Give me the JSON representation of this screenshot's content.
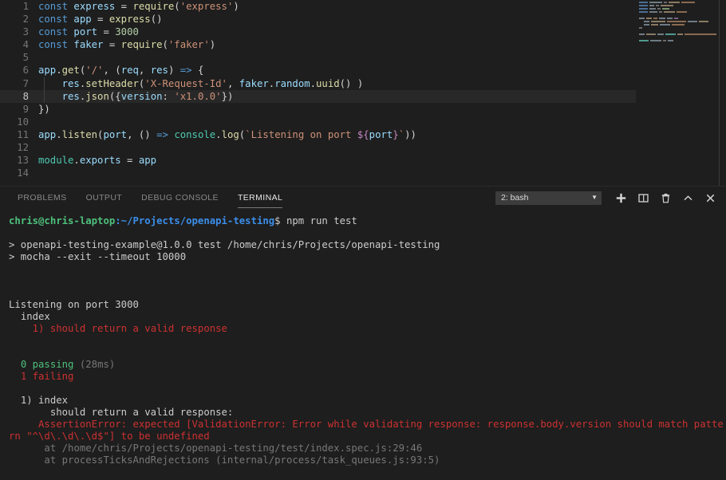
{
  "editor": {
    "lines": [
      {
        "num": "1",
        "active": false,
        "tokens": [
          {
            "t": "const ",
            "c": "t-kw"
          },
          {
            "t": "express",
            "c": "t-var"
          },
          {
            "t": " = ",
            "c": "t-op"
          },
          {
            "t": "require",
            "c": "t-fn"
          },
          {
            "t": "(",
            "c": "t-punc"
          },
          {
            "t": "'express'",
            "c": "t-str"
          },
          {
            "t": ")",
            "c": "t-punc"
          }
        ]
      },
      {
        "num": "2",
        "active": false,
        "tokens": [
          {
            "t": "const ",
            "c": "t-kw"
          },
          {
            "t": "app",
            "c": "t-var"
          },
          {
            "t": " = ",
            "c": "t-op"
          },
          {
            "t": "express",
            "c": "t-fn"
          },
          {
            "t": "()",
            "c": "t-punc"
          }
        ]
      },
      {
        "num": "3",
        "active": false,
        "tokens": [
          {
            "t": "const ",
            "c": "t-kw"
          },
          {
            "t": "port",
            "c": "t-var"
          },
          {
            "t": " = ",
            "c": "t-op"
          },
          {
            "t": "3000",
            "c": "t-num"
          }
        ]
      },
      {
        "num": "4",
        "active": false,
        "tokens": [
          {
            "t": "const ",
            "c": "t-kw"
          },
          {
            "t": "faker",
            "c": "t-var"
          },
          {
            "t": " = ",
            "c": "t-op"
          },
          {
            "t": "require",
            "c": "t-fn"
          },
          {
            "t": "(",
            "c": "t-punc"
          },
          {
            "t": "'faker'",
            "c": "t-str"
          },
          {
            "t": ")",
            "c": "t-punc"
          }
        ]
      },
      {
        "num": "5",
        "active": false,
        "tokens": []
      },
      {
        "num": "6",
        "active": false,
        "tokens": [
          {
            "t": "app",
            "c": "t-var"
          },
          {
            "t": ".",
            "c": "t-punc"
          },
          {
            "t": "get",
            "c": "t-fn"
          },
          {
            "t": "(",
            "c": "t-punc"
          },
          {
            "t": "'/'",
            "c": "t-str"
          },
          {
            "t": ", (",
            "c": "t-punc"
          },
          {
            "t": "req",
            "c": "t-var"
          },
          {
            "t": ", ",
            "c": "t-punc"
          },
          {
            "t": "res",
            "c": "t-var"
          },
          {
            "t": ") ",
            "c": "t-punc"
          },
          {
            "t": "=>",
            "c": "t-kw"
          },
          {
            "t": " {",
            "c": "t-punc"
          }
        ]
      },
      {
        "num": "7",
        "active": false,
        "indent": true,
        "tokens": [
          {
            "t": "    ",
            "c": "t-punc"
          },
          {
            "t": "res",
            "c": "t-var"
          },
          {
            "t": ".",
            "c": "t-punc"
          },
          {
            "t": "setHeader",
            "c": "t-fn"
          },
          {
            "t": "(",
            "c": "t-punc"
          },
          {
            "t": "'X-Request-Id'",
            "c": "t-str"
          },
          {
            "t": ", ",
            "c": "t-punc"
          },
          {
            "t": "faker",
            "c": "t-var"
          },
          {
            "t": ".",
            "c": "t-punc"
          },
          {
            "t": "random",
            "c": "t-var"
          },
          {
            "t": ".",
            "c": "t-punc"
          },
          {
            "t": "uuid",
            "c": "t-fn"
          },
          {
            "t": "() )",
            "c": "t-punc"
          }
        ]
      },
      {
        "num": "8",
        "active": true,
        "indent": true,
        "tokens": [
          {
            "t": "    ",
            "c": "t-punc"
          },
          {
            "t": "res",
            "c": "t-var"
          },
          {
            "t": ".",
            "c": "t-punc"
          },
          {
            "t": "json",
            "c": "t-fn"
          },
          {
            "t": "({",
            "c": "t-punc"
          },
          {
            "t": "version",
            "c": "t-var"
          },
          {
            "t": ": ",
            "c": "t-punc"
          },
          {
            "t": "'x1.0.0'",
            "c": "t-str"
          },
          {
            "t": "})",
            "c": "t-punc"
          }
        ]
      },
      {
        "num": "9",
        "active": false,
        "tokens": [
          {
            "t": "})",
            "c": "t-punc"
          }
        ]
      },
      {
        "num": "10",
        "active": false,
        "tokens": []
      },
      {
        "num": "11",
        "active": false,
        "tokens": [
          {
            "t": "app",
            "c": "t-var"
          },
          {
            "t": ".",
            "c": "t-punc"
          },
          {
            "t": "listen",
            "c": "t-fn"
          },
          {
            "t": "(",
            "c": "t-punc"
          },
          {
            "t": "port",
            "c": "t-var"
          },
          {
            "t": ", () ",
            "c": "t-punc"
          },
          {
            "t": "=>",
            "c": "t-kw"
          },
          {
            "t": " ",
            "c": "t-punc"
          },
          {
            "t": "console",
            "c": "t-obj"
          },
          {
            "t": ".",
            "c": "t-punc"
          },
          {
            "t": "log",
            "c": "t-fn"
          },
          {
            "t": "(",
            "c": "t-punc"
          },
          {
            "t": "`Listening on port ",
            "c": "t-str"
          },
          {
            "t": "${",
            "c": "t-par"
          },
          {
            "t": "port",
            "c": "t-var"
          },
          {
            "t": "}",
            "c": "t-par"
          },
          {
            "t": "`",
            "c": "t-str"
          },
          {
            "t": "))",
            "c": "t-punc"
          }
        ]
      },
      {
        "num": "12",
        "active": false,
        "tokens": []
      },
      {
        "num": "13",
        "active": false,
        "tokens": [
          {
            "t": "module",
            "c": "t-obj"
          },
          {
            "t": ".",
            "c": "t-punc"
          },
          {
            "t": "exports",
            "c": "t-var"
          },
          {
            "t": " = ",
            "c": "t-op"
          },
          {
            "t": "app",
            "c": "t-var"
          }
        ]
      },
      {
        "num": "14",
        "active": false,
        "tokens": []
      }
    ],
    "minimap_rows": [
      {
        "y": 2,
        "blocks": [
          {
            "x": 0,
            "w": 11,
            "c": "#4a6f95"
          },
          {
            "x": 13,
            "w": 16,
            "c": "#6f7b84"
          },
          {
            "x": 31,
            "w": 4,
            "c": "#6b6b6b"
          },
          {
            "x": 37,
            "w": 14,
            "c": "#8a7a63"
          },
          {
            "x": 53,
            "w": 17,
            "c": "#8a6a50"
          }
        ]
      },
      {
        "y": 6,
        "blocks": [
          {
            "x": 0,
            "w": 11,
            "c": "#4a6f95"
          },
          {
            "x": 13,
            "w": 6,
            "c": "#6f7b84"
          },
          {
            "x": 21,
            "w": 4,
            "c": "#6b6b6b"
          },
          {
            "x": 27,
            "w": 16,
            "c": "#8a7a63"
          }
        ]
      },
      {
        "y": 10,
        "blocks": [
          {
            "x": 0,
            "w": 11,
            "c": "#4a6f95"
          },
          {
            "x": 13,
            "w": 8,
            "c": "#6f7b84"
          },
          {
            "x": 23,
            "w": 4,
            "c": "#6b6b6b"
          },
          {
            "x": 29,
            "w": 9,
            "c": "#79916a"
          }
        ]
      },
      {
        "y": 14,
        "blocks": [
          {
            "x": 0,
            "w": 11,
            "c": "#4a6f95"
          },
          {
            "x": 13,
            "w": 10,
            "c": "#6f7b84"
          },
          {
            "x": 25,
            "w": 4,
            "c": "#6b6b6b"
          },
          {
            "x": 31,
            "w": 14,
            "c": "#8a7a63"
          },
          {
            "x": 47,
            "w": 13,
            "c": "#8a6a50"
          }
        ]
      },
      {
        "y": 18,
        "blocks": []
      },
      {
        "y": 22,
        "blocks": [
          {
            "x": 0,
            "w": 7,
            "c": "#6f7b84"
          },
          {
            "x": 9,
            "w": 7,
            "c": "#8a7a63"
          },
          {
            "x": 18,
            "w": 5,
            "c": "#8a6a50"
          },
          {
            "x": 25,
            "w": 8,
            "c": "#6f7b84"
          },
          {
            "x": 35,
            "w": 7,
            "c": "#6f7b84"
          },
          {
            "x": 44,
            "w": 5,
            "c": "#7d5f86"
          }
        ]
      },
      {
        "y": 26,
        "blocks": [
          {
            "x": 6,
            "w": 7,
            "c": "#6f7b84"
          },
          {
            "x": 15,
            "w": 18,
            "c": "#8a7a63"
          },
          {
            "x": 35,
            "w": 24,
            "c": "#8a6a50"
          },
          {
            "x": 61,
            "w": 12,
            "c": "#6f7b84"
          },
          {
            "x": 75,
            "w": 12,
            "c": "#8a7a63"
          }
        ]
      },
      {
        "y": 30,
        "blocks": [
          {
            "x": 6,
            "w": 7,
            "c": "#6f7b84"
          },
          {
            "x": 15,
            "w": 9,
            "c": "#8a7a63"
          },
          {
            "x": 26,
            "w": 13,
            "c": "#6f7b84"
          },
          {
            "x": 41,
            "w": 16,
            "c": "#8a6a50"
          }
        ]
      },
      {
        "y": 34,
        "blocks": [
          {
            "x": 0,
            "w": 4,
            "c": "#6b6b6b"
          }
        ]
      },
      {
        "y": 38,
        "blocks": []
      },
      {
        "y": 42,
        "blocks": [
          {
            "x": 0,
            "w": 7,
            "c": "#6f7b84"
          },
          {
            "x": 9,
            "w": 12,
            "c": "#8a7a63"
          },
          {
            "x": 23,
            "w": 8,
            "c": "#6f7b84"
          },
          {
            "x": 33,
            "w": 13,
            "c": "#4e998c"
          },
          {
            "x": 48,
            "w": 7,
            "c": "#8a7a63"
          },
          {
            "x": 57,
            "w": 40,
            "c": "#8a6a50"
          }
        ]
      },
      {
        "y": 46,
        "blocks": []
      },
      {
        "y": 50,
        "blocks": [
          {
            "x": 0,
            "w": 12,
            "c": "#4e998c"
          },
          {
            "x": 14,
            "w": 14,
            "c": "#6f7b84"
          },
          {
            "x": 30,
            "w": 4,
            "c": "#6b6b6b"
          },
          {
            "x": 36,
            "w": 7,
            "c": "#6f7b84"
          }
        ]
      },
      {
        "y": 54,
        "blocks": []
      }
    ]
  },
  "panel": {
    "tabs": [
      {
        "label": "PROBLEMS",
        "active": false
      },
      {
        "label": "OUTPUT",
        "active": false
      },
      {
        "label": "DEBUG CONSOLE",
        "active": false
      },
      {
        "label": "TERMINAL",
        "active": true
      }
    ],
    "terminal_select": {
      "value": "2: bash",
      "arrow": "▼"
    },
    "actions": [
      {
        "name": "new-terminal-button",
        "icon": "plus-icon"
      },
      {
        "name": "split-terminal-button",
        "icon": "split-panel-icon"
      },
      {
        "name": "kill-terminal-button",
        "icon": "trash-icon"
      },
      {
        "name": "collapse-panel-button",
        "icon": "chevron-up-icon"
      },
      {
        "name": "close-panel-button",
        "icon": "close-icon"
      }
    ]
  },
  "terminal": {
    "prompt": {
      "user_host": "chris@chris-laptop",
      "separator": ":",
      "path": "~/Projects/openapi-testing",
      "dollar": "$ ",
      "command": "npm run test"
    },
    "lines": [
      {
        "spans": [
          {
            "t": "",
            "c": "g-white"
          }
        ]
      },
      {
        "spans": [
          {
            "t": "> openapi-testing-example@1.0.0 test /home/chris/Projects/openapi-testing",
            "c": "g-white"
          }
        ]
      },
      {
        "spans": [
          {
            "t": "> mocha --exit --timeout 10000",
            "c": "g-white"
          }
        ]
      },
      {
        "spans": [
          {
            "t": "",
            "c": "g-white"
          }
        ]
      },
      {
        "spans": [
          {
            "t": "",
            "c": "g-white"
          }
        ]
      },
      {
        "spans": [
          {
            "t": "",
            "c": "g-white"
          }
        ]
      },
      {
        "spans": [
          {
            "t": "Listening on port 3000",
            "c": "g-white"
          }
        ]
      },
      {
        "spans": [
          {
            "t": "  index",
            "c": "g-white"
          }
        ]
      },
      {
        "spans": [
          {
            "t": "    1) should return a valid response",
            "c": "g-red"
          }
        ]
      },
      {
        "spans": [
          {
            "t": "",
            "c": "g-white"
          }
        ]
      },
      {
        "spans": [
          {
            "t": "",
            "c": "g-white"
          }
        ]
      },
      {
        "spans": [
          {
            "t": "  0 passing ",
            "c": "g-green"
          },
          {
            "t": "(28ms)",
            "c": "g-dim"
          }
        ]
      },
      {
        "spans": [
          {
            "t": "  1 failing",
            "c": "g-red"
          }
        ]
      },
      {
        "spans": [
          {
            "t": "",
            "c": "g-white"
          }
        ]
      },
      {
        "spans": [
          {
            "t": "  1) index",
            "c": "g-white"
          }
        ]
      },
      {
        "spans": [
          {
            "t": "       should return a valid response:",
            "c": "g-white"
          }
        ]
      },
      {
        "spans": [
          {
            "t": "     AssertionError: expected [ValidationError: Error while validating response: response.body.version should match pattern \"^\\d\\.\\d\\.\\d$\"] to be undefined",
            "c": "g-red"
          }
        ]
      },
      {
        "spans": [
          {
            "t": "      at /home/chris/Projects/openapi-testing/test/index.spec.js:29:46",
            "c": "g-dim"
          }
        ]
      },
      {
        "spans": [
          {
            "t": "      at processTicksAndRejections (internal/process/task_queues.js:93:5)",
            "c": "g-dim"
          }
        ]
      }
    ]
  },
  "colors": {
    "editor_bg": "#1e1e1e",
    "active_line_bg": "#282828",
    "panel_bg": "#1e1e1e",
    "accent_green": "#4ec07c",
    "accent_blue": "#3b8eea",
    "accent_red": "#cd3131"
  }
}
